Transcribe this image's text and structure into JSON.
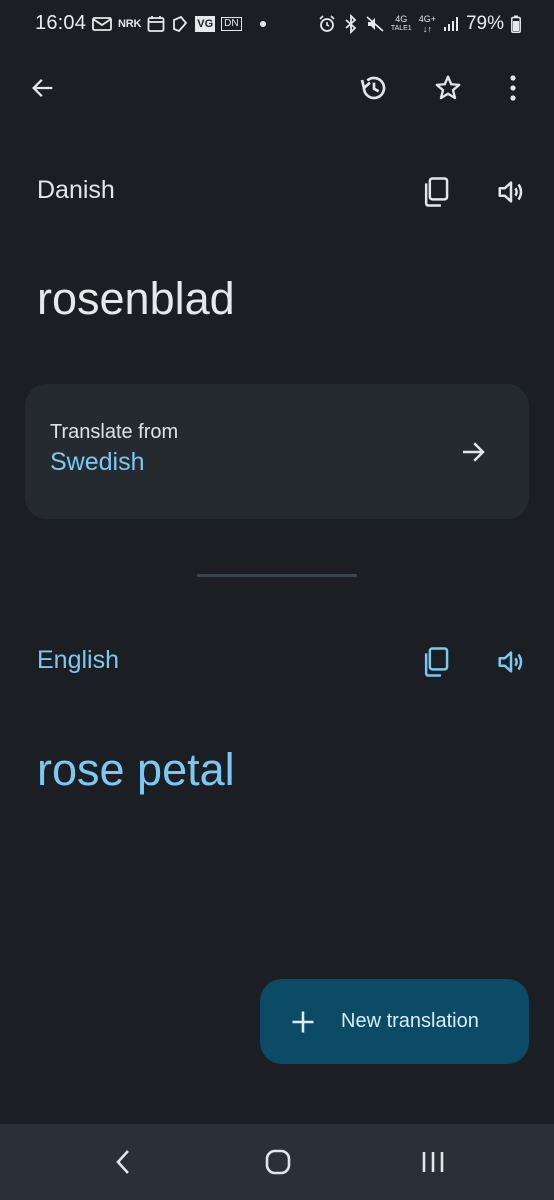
{
  "status_bar": {
    "time": "16:04",
    "battery_percent": "79%",
    "network_1": "4G",
    "network_1_sub": "TALE1",
    "network_2": "4G+",
    "nrk_label": "NRK",
    "vg_label": "VG",
    "dn_label": "DN"
  },
  "app_bar": {
    "back_icon": "arrow-left-icon",
    "history_icon": "history-icon",
    "favorite_icon": "star-outline-icon",
    "more_icon": "more-vert-icon"
  },
  "source": {
    "language": "Danish",
    "text": "rosenblad",
    "copy_icon": "copy-icon",
    "speaker_icon": "speaker-icon"
  },
  "translate_from": {
    "title": "Translate from",
    "language": "Swedish",
    "arrow_icon": "arrow-right-icon"
  },
  "target": {
    "language": "English",
    "text": "rose petal",
    "copy_icon": "copy-icon",
    "speaker_icon": "speaker-icon"
  },
  "fab": {
    "label": "New translation",
    "icon": "plus-icon"
  },
  "nav": {
    "back_icon": "nav-back-icon",
    "home_icon": "nav-home-icon",
    "recents_icon": "nav-recents-icon"
  },
  "colors": {
    "background": "#1b1f23",
    "card": "#242a2e",
    "accent": "#7cc8f2",
    "fab": "#0b4b66",
    "nav": "#2a3035"
  }
}
